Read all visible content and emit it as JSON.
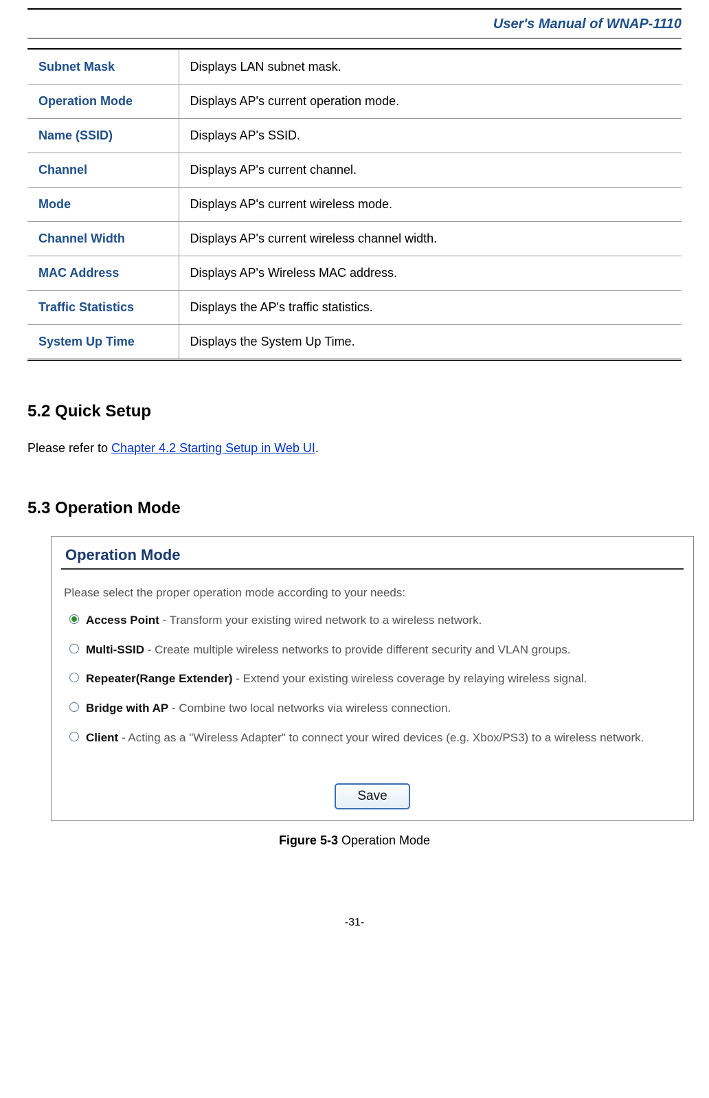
{
  "header": {
    "title": "User's Manual of WNAP-1110"
  },
  "table_rows": [
    {
      "key": "Subnet Mask",
      "val": "Displays LAN subnet mask."
    },
    {
      "key": "Operation Mode",
      "val": "Displays AP's current operation mode."
    },
    {
      "key": "Name (SSID)",
      "val": "Displays AP's SSID."
    },
    {
      "key": "Channel",
      "val": "Displays AP's current channel."
    },
    {
      "key": "Mode",
      "val": "Displays AP's current wireless mode."
    },
    {
      "key": "Channel Width",
      "val": "Displays AP's current wireless channel width."
    },
    {
      "key": "MAC Address",
      "val": "Displays AP's Wireless MAC address."
    },
    {
      "key": "Traffic Statistics",
      "val": "Displays the AP's traffic statistics."
    },
    {
      "key": "System Up Time",
      "val": "Displays the System Up Time."
    }
  ],
  "sections": {
    "s52": {
      "heading": "5.2    Quick Setup",
      "lead": "Please refer to ",
      "link": "Chapter 4.2 Starting Setup in Web UI",
      "tail": "."
    },
    "s53": {
      "heading": "5.3    Operation Mode"
    }
  },
  "figure": {
    "title": "Operation Mode",
    "lead": "Please select the proper operation mode according to your needs:",
    "options": [
      {
        "label": "Access Point",
        "desc": " - Transform your existing wired network to a wireless network.",
        "selected": true
      },
      {
        "label": "Multi-SSID",
        "desc": " - Create multiple wireless networks to provide different security and VLAN groups.",
        "selected": false
      },
      {
        "label": "Repeater(Range Extender)",
        "desc": " - Extend your existing wireless coverage by relaying wireless signal.",
        "selected": false
      },
      {
        "label": "Bridge with AP",
        "desc": " - Combine two local networks via wireless connection.",
        "selected": false
      },
      {
        "label": "Client",
        "desc": " - Acting as a \"Wireless Adapter\" to connect your wired devices (e.g. Xbox/PS3) to a wireless network.",
        "selected": false
      }
    ],
    "save": "Save",
    "caption_bold": "Figure 5-3",
    "caption_rest": "    Operation Mode"
  },
  "page_number": "-31-"
}
